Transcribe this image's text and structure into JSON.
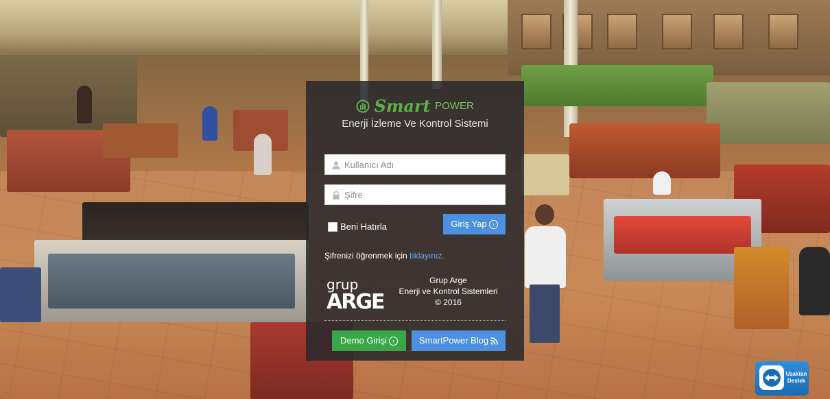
{
  "brand": {
    "name_smart": "Smart",
    "name_power": "POWER",
    "subtitle": "Enerji İzleme Ve Kontrol Sistemi",
    "accent_green": "#5fb048"
  },
  "login": {
    "username_placeholder": "Kullanıcı Adı",
    "password_placeholder": "Şifre",
    "remember_label": "Beni Hatırla",
    "login_button": "Giriş Yap",
    "forgot_text": "Şifrenizi öğrenmek için",
    "forgot_link": "tıklayınız."
  },
  "company": {
    "logo_top": "grup",
    "logo_bottom": "ARGE",
    "line1": "Grup Arge",
    "line2": "Enerji ve Kontrol Sistemleri",
    "line3": "© 2016"
  },
  "actions": {
    "demo_button": "Demo Girişi",
    "blog_button": "SmartPower Blog"
  },
  "remote_support": {
    "line1": "Uzaktan",
    "line2": "Destek"
  },
  "colors": {
    "primary_blue": "#4d8fe0",
    "demo_green": "#3aa64a",
    "panel_bg": "#28282c"
  }
}
